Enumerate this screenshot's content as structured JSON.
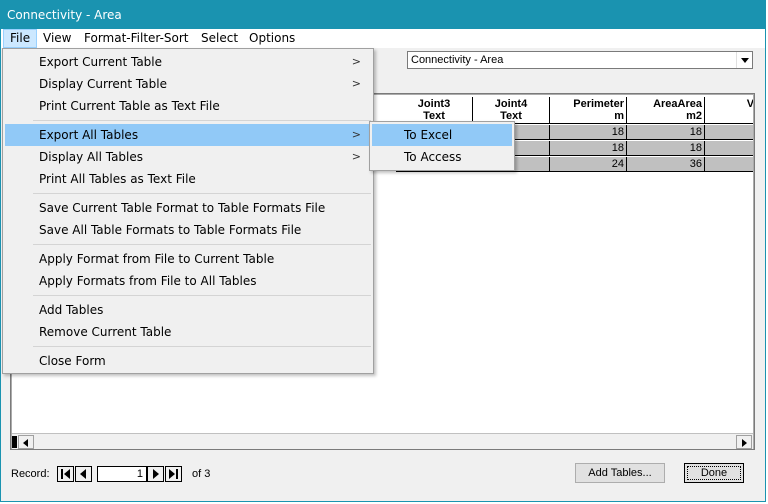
{
  "window": {
    "title": "Connectivity - Area"
  },
  "menubar": [
    "File",
    "View",
    "Format-Filter-Sort",
    "Select",
    "Options"
  ],
  "table_selector": {
    "value": "Connectivity - Area"
  },
  "table": {
    "columns": [
      {
        "line1": "Joint3",
        "line2": "Text"
      },
      {
        "line1": "Joint4",
        "line2": "Text"
      },
      {
        "line1": "Perimeter",
        "line2": "m"
      },
      {
        "line1": "AreaArea",
        "line2": "m2"
      },
      {
        "line1": "Vol",
        "line2": ""
      }
    ],
    "rows": [
      [
        "",
        "",
        "18",
        "18",
        ""
      ],
      [
        "",
        "",
        "18",
        "18",
        ""
      ],
      [
        "",
        "",
        "24",
        "36",
        ""
      ]
    ]
  },
  "file_menu": {
    "items": [
      {
        "label": "Export Current Table",
        "submenu": true
      },
      {
        "label": "Display Current Table",
        "submenu": true
      },
      {
        "label": "Print Current Table as Text File",
        "submenu": false
      },
      {
        "label": "Export All Tables",
        "submenu": true,
        "highlighted": true
      },
      {
        "label": "Display All Tables",
        "submenu": true
      },
      {
        "label": "Print All Tables as Text File",
        "submenu": false
      },
      {
        "label": "Save Current Table Format to Table Formats File",
        "submenu": false
      },
      {
        "label": "Save All Table Formats to Table Formats File",
        "submenu": false
      },
      {
        "label": "Apply Format from File to Current Table",
        "submenu": false
      },
      {
        "label": "Apply Formats from File to All Tables",
        "submenu": false
      },
      {
        "label": "Add Tables",
        "submenu": false
      },
      {
        "label": "Remove Current Table",
        "submenu": false
      },
      {
        "label": "Close Form",
        "submenu": false
      }
    ],
    "submenu_arrow": ">"
  },
  "export_submenu": [
    "To Excel",
    "To Access"
  ],
  "record_nav": {
    "label": "Record:",
    "current": "1",
    "of_text": "of 3"
  },
  "buttons": {
    "add_tables": "Add Tables...",
    "done": "Done"
  },
  "colors": {
    "titlebar": "#1a93b0",
    "highlight": "#91c9f7",
    "cell_bg": "#c0c0c0"
  }
}
